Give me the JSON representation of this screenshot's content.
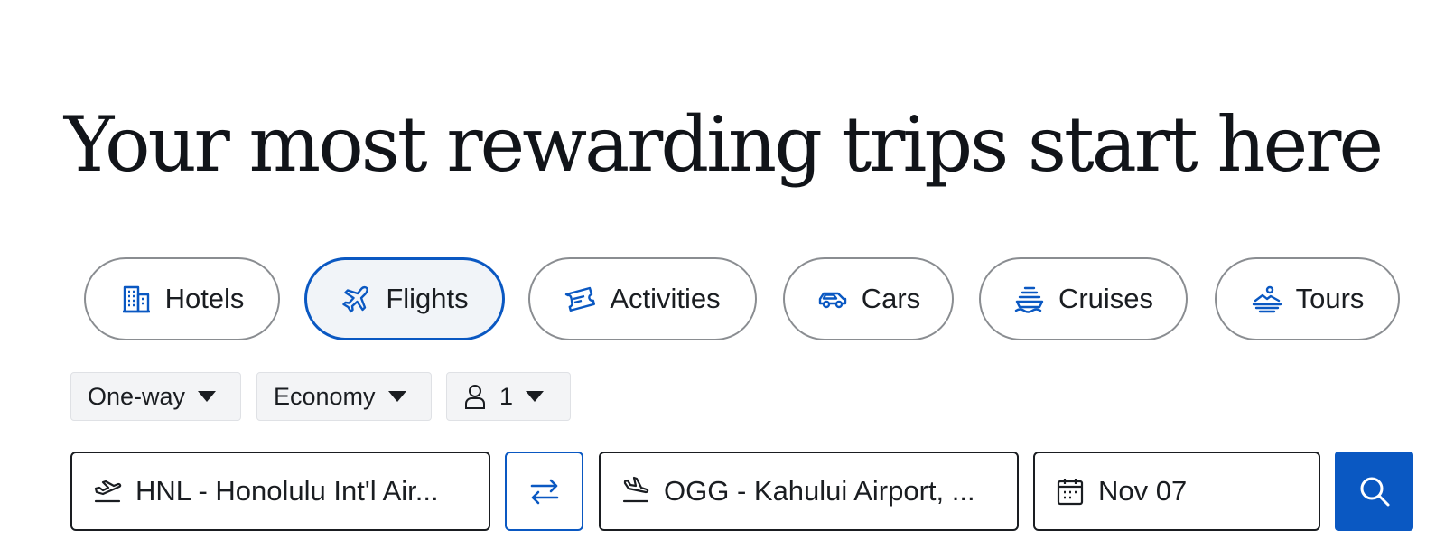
{
  "headline": "Your most rewarding trips start here",
  "tabs": [
    {
      "label": "Hotels",
      "icon": "hotel-icon",
      "active": false
    },
    {
      "label": "Flights",
      "icon": "plane-icon",
      "active": true
    },
    {
      "label": "Activities",
      "icon": "ticket-icon",
      "active": false
    },
    {
      "label": "Cars",
      "icon": "car-icon",
      "active": false
    },
    {
      "label": "Cruises",
      "icon": "ship-icon",
      "active": false
    },
    {
      "label": "Tours",
      "icon": "tour-icon",
      "active": false
    }
  ],
  "options": {
    "trip_type": "One-way",
    "cabin_class": "Economy",
    "travelers": "1"
  },
  "search": {
    "origin": "HNL - Honolulu Int'l Air...",
    "destination": "OGG - Kahului Airport, ...",
    "date": "Nov 07"
  },
  "colors": {
    "accent": "#0a58c2",
    "text": "#1a1d21",
    "active_tab_bg": "#f1f4f8"
  }
}
